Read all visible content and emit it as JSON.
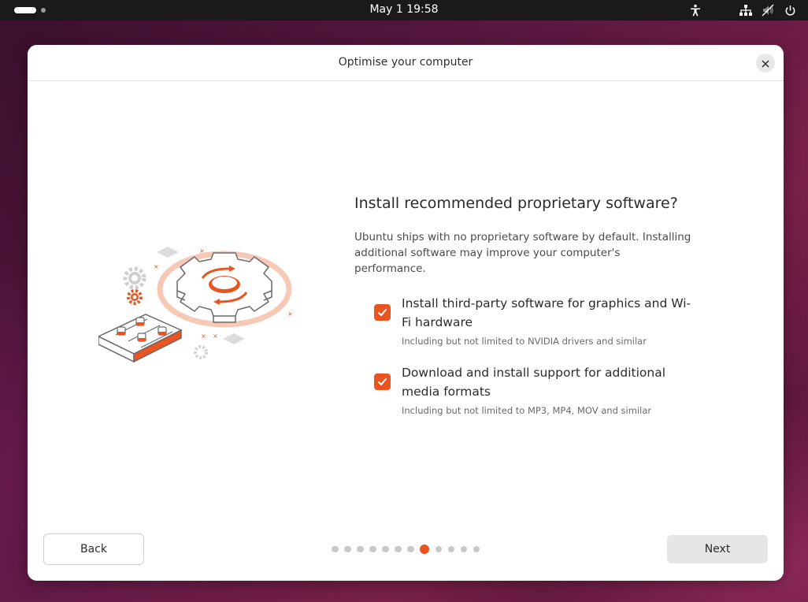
{
  "topbar": {
    "clock": "May 1  19:58",
    "icons": [
      "accessibility-icon",
      "network-icon",
      "volume-muted-icon",
      "power-icon"
    ]
  },
  "window": {
    "title": "Optimise your computer",
    "close_icon": "close-icon"
  },
  "main": {
    "heading": "Install recommended proprietary software?",
    "description": "Ubuntu ships with no proprietary software by default. Installing additional software may improve your computer's performance.",
    "options": [
      {
        "label": "Install third-party software for graphics and Wi-Fi hardware",
        "hint": "Including but not limited to NVIDIA drivers and similar",
        "checked": true
      },
      {
        "label": "Download and install support for additional media formats",
        "hint": "Including but not limited to MP3, MP4, MOV and similar",
        "checked": true
      }
    ]
  },
  "footer": {
    "back_label": "Back",
    "next_label": "Next",
    "page_count": 12,
    "current_page": 8
  },
  "colors": {
    "accent": "#e95420",
    "topbar": "#1a1a1a"
  }
}
